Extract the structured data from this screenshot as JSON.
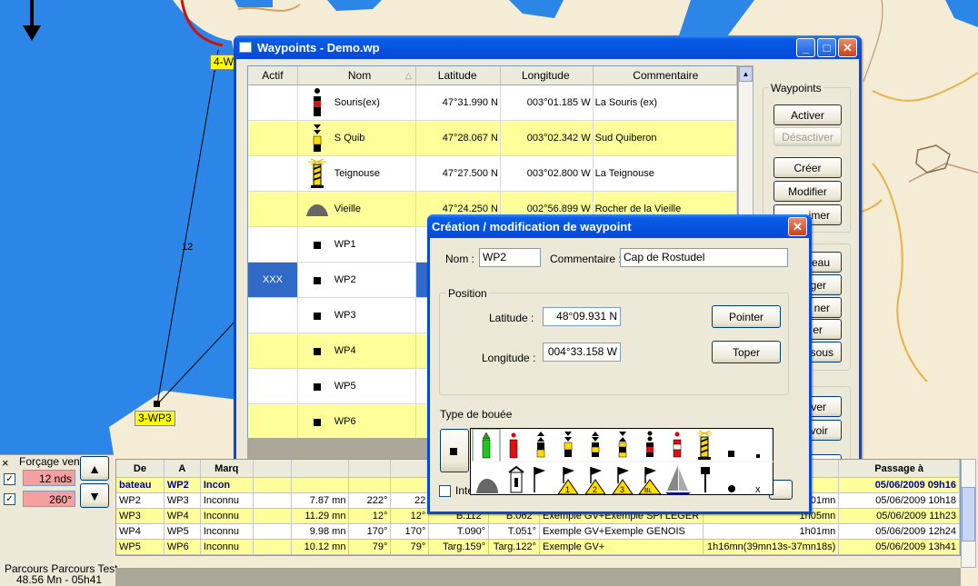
{
  "map": {
    "labels": {
      "wp4_partial": "4-W",
      "wp3": "3-WP3",
      "leg_number": "12"
    }
  },
  "waypoints_window": {
    "title": "Waypoints - Demo.wp",
    "columns": [
      "Actif",
      "Nom",
      "Latitude",
      "Longitude",
      "Commentaire"
    ],
    "rows": [
      {
        "actif": "",
        "icon": "cardinal-buoy-black-red-icon",
        "nom": "Souris(ex)",
        "lat": "47°31.990 N",
        "lon": "003°01.185 W",
        "comment": "La Souris (ex)",
        "color": "white"
      },
      {
        "actif": "",
        "icon": "south-cardinal-buoy-icon",
        "nom": "S Quib",
        "lat": "47°28.067 N",
        "lon": "003°02.342 W",
        "comment": "Sud Quiberon",
        "color": "yellow"
      },
      {
        "actif": "",
        "icon": "lighthouse-icon",
        "nom": "Teignouse",
        "lat": "47°27.500 N",
        "lon": "003°02.800 W",
        "comment": "La Teignouse",
        "color": "white"
      },
      {
        "actif": "",
        "icon": "rock-icon",
        "nom": "Vieille",
        "lat": "47°24.250 N",
        "lon": "002°56.899 W",
        "comment": "Rocher de la Vieille",
        "color": "yellow"
      },
      {
        "actif": "",
        "icon": "square-mark-icon",
        "nom": "WP1",
        "lat": "",
        "lon": "",
        "comment": "",
        "color": "white"
      },
      {
        "actif": "XXX",
        "icon": "square-mark-icon",
        "nom": "WP2",
        "lat": "",
        "lon": "",
        "comment": "",
        "color": "selected"
      },
      {
        "actif": "",
        "icon": "square-mark-icon",
        "nom": "WP3",
        "lat": "",
        "lon": "",
        "comment": "",
        "color": "white"
      },
      {
        "actif": "",
        "icon": "square-mark-icon",
        "nom": "WP4",
        "lat": "",
        "lon": "",
        "comment": "",
        "color": "yellow"
      },
      {
        "actif": "",
        "icon": "square-mark-icon",
        "nom": "WP5",
        "lat": "",
        "lon": "",
        "comment": "",
        "color": "white"
      },
      {
        "actif": "",
        "icon": "square-mark-icon",
        "nom": "WP6",
        "lat": "",
        "lon": "",
        "comment": "",
        "color": "yellow"
      }
    ],
    "group_label": "Waypoints",
    "buttons": {
      "activer": "Activer",
      "desactiver": "Désactiver",
      "creer": "Créer",
      "modifier": "Modifier",
      "supprimer_partial": "imer",
      "bateau_partial": "eau",
      "b2_partial": "ger",
      "b3_partial": "ner",
      "b4_partial": "er",
      "sous_partial": "sous",
      "b6_partial": "ver",
      "b7_partial": "voir",
      "b8_partial": "er"
    }
  },
  "edit_dialog": {
    "title": "Création / modification de waypoint",
    "nom_label": "Nom :",
    "nom_value": "WP2",
    "comment_label": "Commentaire :",
    "comment_value": "Cap de Rostudel",
    "position_label": "Position",
    "lat_label": "Latitude :",
    "lat_value": "48°09.931 N",
    "lon_label": "Longitude :",
    "lon_value": "004°33.158 W",
    "pointer_btn": "Pointer",
    "toper_btn": "Toper",
    "buoy_type_label": "Type de bouée",
    "inter_partial": "Inte"
  },
  "wind_panel": {
    "label": "Forçage vent",
    "speed": "12 nds",
    "direction": "260°",
    "close": "×",
    "up": "▲",
    "down": "▼"
  },
  "route_info": {
    "name": "Parcours Parcours Test",
    "stats": "48.56 Mn - 05h41"
  },
  "legs_table": {
    "headers": [
      "De",
      "A",
      "Marq",
      "",
      "",
      "",
      "",
      "",
      "",
      "",
      "",
      "Passage à"
    ],
    "rows": [
      {
        "cells": [
          "bateau",
          "WP2",
          "Incon",
          "",
          "",
          "",
          "",
          "",
          "",
          "",
          "",
          "05/06/2009 09h16"
        ],
        "style": "bold"
      },
      {
        "cells": [
          "WP2",
          "WP3",
          "Inconnu",
          "",
          "7.87 mn",
          "222°",
          "22",
          "",
          "",
          "",
          "1h01mn",
          "05/06/2009 10h18"
        ],
        "style": "white"
      },
      {
        "cells": [
          "WP3",
          "WP4",
          "Inconnu",
          "",
          "11.29 mn",
          "12°",
          "12°",
          "B.112°",
          "B.062°",
          "Exemple GV+Exemple SPI LEGER",
          "1h05mn",
          "05/06/2009 11h23"
        ],
        "style": "yellow"
      },
      {
        "cells": [
          "WP4",
          "WP5",
          "Inconnu",
          "",
          "9.98 mn",
          "170°",
          "170°",
          "T.090°",
          "T.051°",
          "Exemple GV+Exemple GENOIS",
          "1h01mn",
          "05/06/2009 12h24"
        ],
        "style": "white"
      },
      {
        "cells": [
          "WP5",
          "WP6",
          "Inconnu",
          "",
          "10.12 mn",
          "79°",
          "79°",
          "Targ.159°",
          "Targ.122°",
          "Exemple GV+",
          "1h16mn(39mn13s-37mn18s)",
          "05/06/2009 13h41"
        ],
        "style": "yellow"
      }
    ]
  },
  "colors": {
    "sea": "#2b86e8",
    "land": "#f5ecd6",
    "titlebar": "#0a5ce8",
    "row_yellow": "#ffff99",
    "selection": "#3169c6"
  }
}
